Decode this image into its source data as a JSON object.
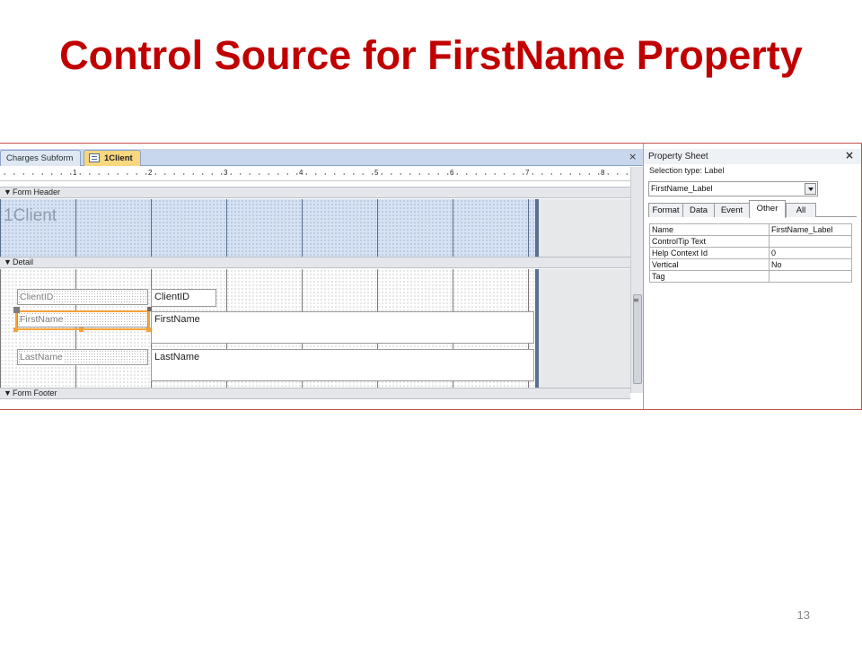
{
  "slide": {
    "title": "Control Source for FirstName Property",
    "page_number": "13"
  },
  "designer": {
    "tabs": [
      {
        "label": "Charges Subform",
        "active": false
      },
      {
        "label": "1Client",
        "active": true
      }
    ],
    "close_glyph": "×",
    "ruler_numbers": [
      "1",
      "2",
      "3",
      "4",
      "5",
      "6",
      "7",
      "8"
    ],
    "sections": {
      "header": "Form Header",
      "detail": "Detail",
      "footer": "Form Footer"
    },
    "header_caption": "1Client",
    "controls": {
      "client_id_label": "ClientID",
      "client_id_textbox": "ClientID",
      "first_name_label": "FirstName",
      "first_name_textbox": "FirstName",
      "last_name_label": "LastName",
      "last_name_textbox": "LastName"
    },
    "selected_control": "FirstName_Label",
    "section_arrow_icon": "section-collapse-arrow",
    "colors": {
      "selection": "#f2a33a",
      "active_tab": "#f9d77e",
      "header_grid": "#d6e2f4"
    }
  },
  "property_sheet": {
    "title": "Property Sheet",
    "close_glyph": "×",
    "selection_type": "Selection type:  Label",
    "selected_object": "FirstName_Label",
    "tabs": [
      "Format",
      "Data",
      "Event",
      "Other",
      "All"
    ],
    "active_tab": "Other",
    "properties": [
      {
        "name": "Name",
        "value": "FirstName_Label"
      },
      {
        "name": "ControlTip Text",
        "value": ""
      },
      {
        "name": "Help Context Id",
        "value": "0"
      },
      {
        "name": "Vertical",
        "value": "No"
      },
      {
        "name": "Tag",
        "value": ""
      }
    ]
  },
  "accent_color": "#c00000"
}
